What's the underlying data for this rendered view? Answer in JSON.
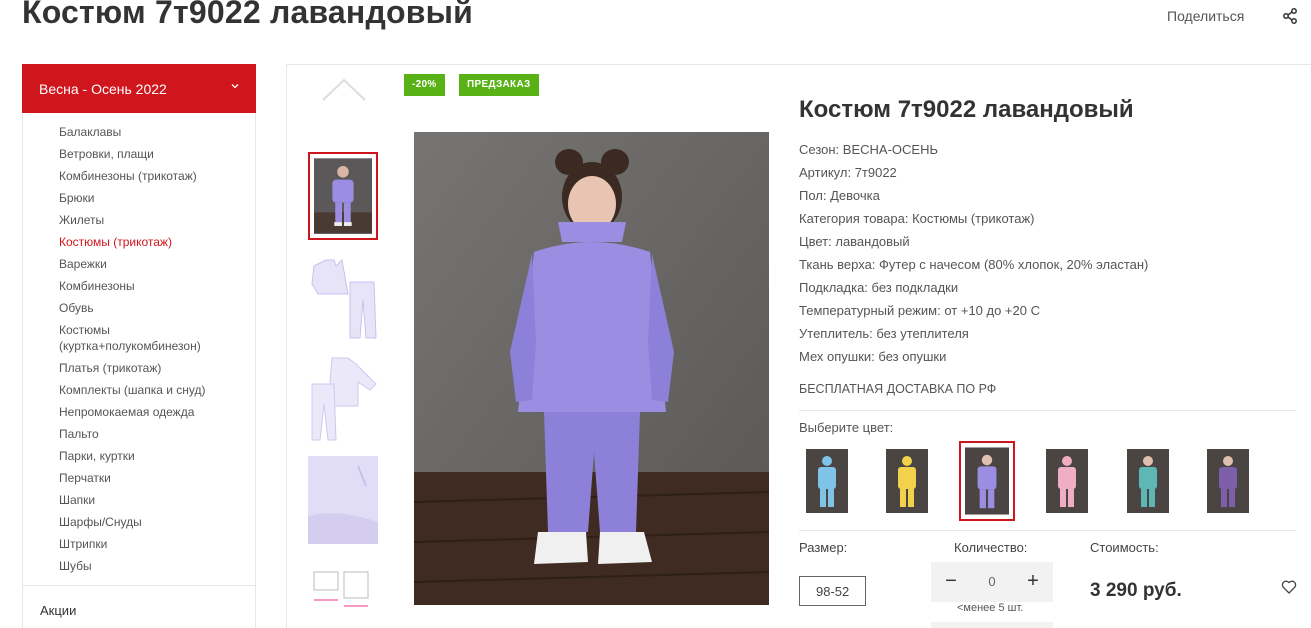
{
  "page": {
    "title": "Костюм 7т9022 лавандовый",
    "share_label": "Поделиться"
  },
  "sidebar": {
    "header": "Весна - Осень 2022",
    "items": [
      {
        "label": "Балаклавы"
      },
      {
        "label": "Ветровки, плащи"
      },
      {
        "label": "Комбинезоны (трикотаж)"
      },
      {
        "label": "Брюки"
      },
      {
        "label": "Жилеты"
      },
      {
        "label": "Костюмы (трикотаж)",
        "active": true
      },
      {
        "label": "Варежки"
      },
      {
        "label": "Комбинезоны"
      },
      {
        "label": "Обувь"
      },
      {
        "label": "Костюмы (куртка+полукомбинезон)"
      },
      {
        "label": "Платья (трикотаж)"
      },
      {
        "label": "Комплекты (шапка и снуд)"
      },
      {
        "label": "Непромокаемая одежда"
      },
      {
        "label": "Пальто"
      },
      {
        "label": "Парки, куртки"
      },
      {
        "label": "Перчатки"
      },
      {
        "label": "Шапки"
      },
      {
        "label": "Шарфы/Снуды"
      },
      {
        "label": "Штрипки"
      },
      {
        "label": "Шубы"
      }
    ],
    "footer_item": "Акции"
  },
  "badges": {
    "discount": "-20%",
    "preorder": "ПРЕДЗАКАЗ"
  },
  "product": {
    "title": "Костюм 7т9022 лавандовый",
    "properties": [
      "Сезон: ВЕСНА-ОСЕНЬ",
      "Артикул: 7т9022",
      "Пол: Девочка",
      "Категория товара: Костюмы (трикотаж)",
      "Цвет: лавандовый",
      "Ткань верха: Футер с начесом (80% хлопок, 20% эластан)",
      "Подкладка: без подкладки",
      "Температурный режим: от +10 до +20 С",
      "Утеплитель: без утеплителя",
      "Мех опушки: без опушки"
    ],
    "delivery": "БЕСПЛАТНАЯ ДОСТАВКА ПО РФ",
    "choose_color_label": "Выберите цвет:",
    "colors": [
      {
        "name": "голубой",
        "color": "#7fc4e8"
      },
      {
        "name": "желтый",
        "color": "#f1d24a"
      },
      {
        "name": "лавандовый",
        "color": "#8e84d8",
        "selected": true
      },
      {
        "name": "розовый",
        "color": "#f0aec4"
      },
      {
        "name": "бирюзовый",
        "color": "#5cb7b5"
      },
      {
        "name": "фиолетовый",
        "color": "#7c5fa8"
      }
    ],
    "size_label": "Размер:",
    "size_value": "98-52",
    "qty_label": "Количество:",
    "qty_value": "0",
    "qty_note": "<менее 5 шт.",
    "cost_label": "Стоимость:",
    "price": "3 290 руб."
  },
  "colors": {
    "accent": "#d0161d",
    "badge_green": "#58b215",
    "lavender": "#9a8de2"
  }
}
